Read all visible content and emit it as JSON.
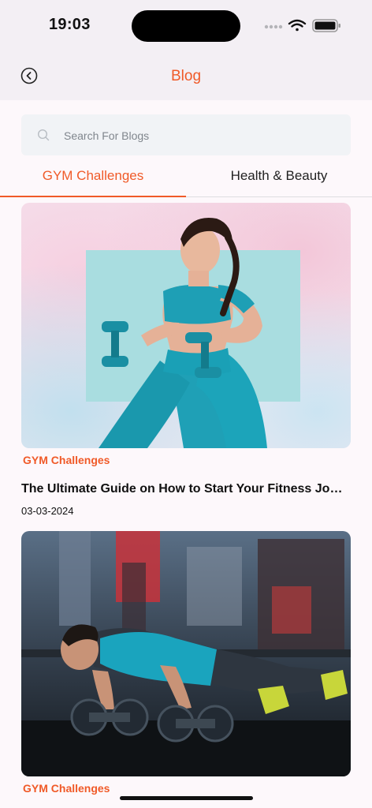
{
  "status_bar": {
    "time": "19:03"
  },
  "header": {
    "title": "Blog",
    "back_icon": "back-arrow-circle-icon"
  },
  "search": {
    "placeholder": "Search For Blogs",
    "value": "",
    "icon": "search-icon"
  },
  "tabs": [
    {
      "label": "GYM Challenges",
      "selected": true
    },
    {
      "label": "Health & Beauty",
      "selected": false
    }
  ],
  "posts": [
    {
      "category": "GYM Challenges",
      "title": "The Ultimate Guide on How to Start Your Fitness Jo…",
      "date": "03-03-2024",
      "image": "woman-with-dumbbells-photo"
    },
    {
      "category": "GYM Challenges",
      "image": "man-doing-pushups-on-dumbbells-photo"
    }
  ],
  "colors": {
    "accent": "#f05a28",
    "header_bg": "#f3eff4",
    "page_bg": "#fdf8fb",
    "search_bg": "#f1f3f6"
  }
}
